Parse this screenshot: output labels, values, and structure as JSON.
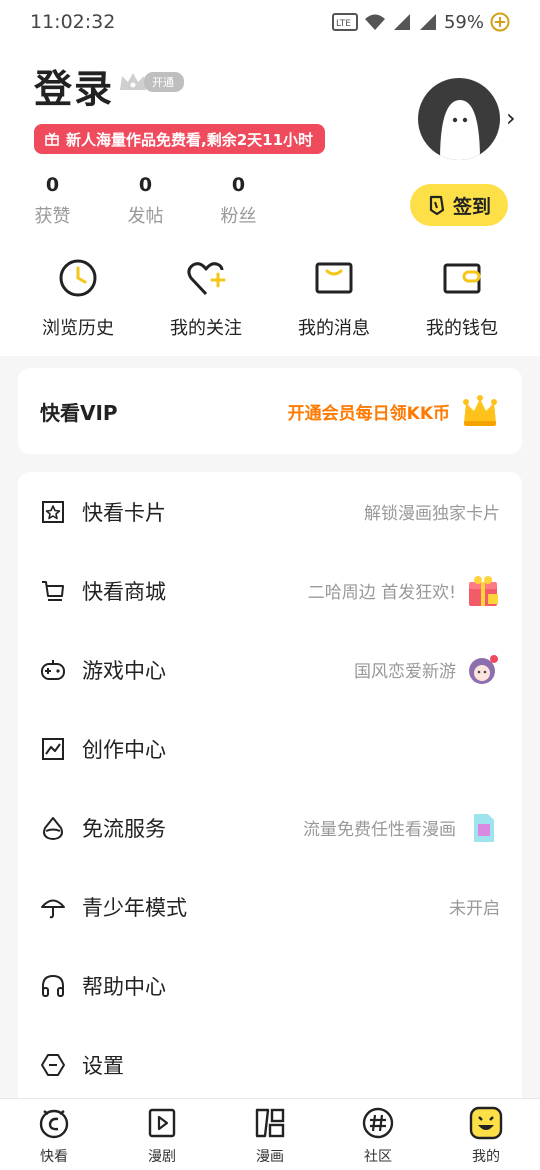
{
  "status": {
    "time": "11:02:32",
    "battery": "59%",
    "network_badge": "4G",
    "signal_badge": "G"
  },
  "profile": {
    "login_label": "登录",
    "vip_badge_label": "开通",
    "promo_text": "新人海量作品免费看,剩余2天11小时",
    "chevron": "›",
    "stats": [
      {
        "value": "0",
        "label": "获赞"
      },
      {
        "value": "0",
        "label": "发帖"
      },
      {
        "value": "0",
        "label": "粉丝"
      }
    ],
    "checkin_label": "签到"
  },
  "quick_actions": [
    {
      "label": "浏览历史",
      "icon": "clock-icon"
    },
    {
      "label": "我的关注",
      "icon": "heart-plus-icon"
    },
    {
      "label": "我的消息",
      "icon": "message-icon"
    },
    {
      "label": "我的钱包",
      "icon": "wallet-icon"
    }
  ],
  "vip": {
    "title": "快看VIP",
    "promo": "开通会员每日领KK币",
    "accent": "#ff7a00"
  },
  "menu": [
    {
      "label": "快看卡片",
      "hint": "解锁漫画独家卡片",
      "icon": "card-icon"
    },
    {
      "label": "快看商城",
      "hint": "二哈周边 首发狂欢!",
      "icon": "cart-icon"
    },
    {
      "label": "游戏中心",
      "hint": "国风恋爱新游",
      "icon": "gamepad-icon"
    },
    {
      "label": "创作中心",
      "hint": "",
      "icon": "chart-icon"
    },
    {
      "label": "免流服务",
      "hint": "流量免费任性看漫画",
      "icon": "drop-icon"
    },
    {
      "label": "青少年模式",
      "hint": "未开启",
      "icon": "umbrella-icon"
    },
    {
      "label": "帮助中心",
      "hint": "",
      "icon": "headphones-icon"
    },
    {
      "label": "设置",
      "hint": "",
      "icon": "settings-icon"
    }
  ],
  "tabs": [
    {
      "label": "快看",
      "icon": "kuaikan-icon"
    },
    {
      "label": "漫剧",
      "icon": "play-icon"
    },
    {
      "label": "漫画",
      "icon": "comic-icon"
    },
    {
      "label": "社区",
      "icon": "hash-icon"
    },
    {
      "label": "我的",
      "icon": "face-icon",
      "active": true
    }
  ],
  "colors": {
    "brand_yellow": "#fde047",
    "promo_red": "#f04a5d"
  }
}
